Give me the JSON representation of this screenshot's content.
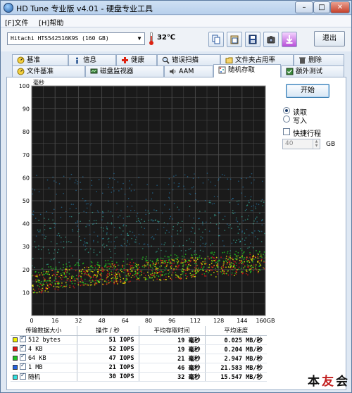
{
  "window": {
    "title": "HD Tune 专业版 v4.01 - 硬盘专业工具",
    "min": "–",
    "max": "□",
    "close": "✕"
  },
  "menu": [
    "[F]文件",
    "[H]帮助"
  ],
  "toolbar": {
    "drive": "Hitachi HTS542516K9S  (160 GB)",
    "temperature": "32℃",
    "exit": "退出",
    "buttons": [
      "copy-icon",
      "paste-icon",
      "save-icon",
      "camera-icon",
      "download-icon"
    ]
  },
  "tabs_row1": [
    {
      "label": "基准",
      "icon": "benchmark-icon"
    },
    {
      "label": "信息",
      "icon": "info-icon"
    },
    {
      "label": "健康",
      "icon": "health-icon"
    },
    {
      "label": "错误扫描",
      "icon": "scan-icon"
    },
    {
      "label": "文件夹占用率",
      "icon": "folder-icon"
    },
    {
      "label": "删除",
      "icon": "trash-icon"
    }
  ],
  "tabs_row2": [
    {
      "label": "文件基准",
      "icon": "file-benchmark-icon"
    },
    {
      "label": "磁盘监视器",
      "icon": "monitor-icon"
    },
    {
      "label": "AAM",
      "icon": "speaker-icon"
    },
    {
      "label": "随机存取",
      "icon": "random-access-icon",
      "active": true
    },
    {
      "label": "额外测试",
      "icon": "extra-tests-icon"
    }
  ],
  "controls": {
    "start": "开始",
    "read": "读取",
    "write": "写入",
    "quick": "快捷行程",
    "quick_value": "40",
    "quick_unit": "GB"
  },
  "chart_data": {
    "type": "scatter",
    "ylabel": "毫秒",
    "ylim": [
      0,
      100
    ],
    "xlim": [
      0,
      160
    ],
    "yticks": [
      "100",
      "90",
      "80",
      "70",
      "60",
      "50",
      "40",
      "30",
      "20",
      "10"
    ],
    "xticks": [
      "0",
      "16",
      "32",
      "48",
      "64",
      "80",
      "96",
      "112",
      "128",
      "144",
      "160GB"
    ],
    "grid": true,
    "background": "#1a1a1a",
    "series": [
      {
        "name": "512 bytes",
        "color": "#f0f000",
        "approx_latency_ms": [
          14,
          20
        ]
      },
      {
        "name": "4 KB",
        "color": "#e01818",
        "approx_latency_ms": [
          14,
          20
        ]
      },
      {
        "name": "64 KB",
        "color": "#20c020",
        "approx_latency_ms": [
          15,
          22
        ]
      },
      {
        "name": "1 MB",
        "color": "#2890d0",
        "approx_latency_ms": [
          30,
          60
        ]
      },
      {
        "name": "随机",
        "color": "#40d8c0",
        "approx_latency_ms": [
          15,
          40
        ]
      }
    ]
  },
  "table": {
    "headers": [
      "传输数据大小",
      "操作 / 秒",
      "平均存取时间",
      "平均速度"
    ],
    "rows": [
      {
        "color": "#f0f000",
        "size": "512 bytes",
        "ops": "51 IOPS",
        "access": "19 毫秒",
        "speed": "0.025 MB/秒"
      },
      {
        "color": "#e01818",
        "size": "4 KB",
        "ops": "52 IOPS",
        "access": "19 毫秒",
        "speed": "0.204 MB/秒"
      },
      {
        "color": "#20c020",
        "size": "64 KB",
        "ops": "47 IOPS",
        "access": "21 毫秒",
        "speed": "2.947 MB/秒"
      },
      {
        "color": "#2060e0",
        "size": "1 MB",
        "ops": "21 IOPS",
        "access": "46 毫秒",
        "speed": "21.583 MB/秒"
      },
      {
        "color": "#30e0e0",
        "size": "随机",
        "ops": "30 IOPS",
        "access": "32 毫秒",
        "speed": "15.547 MB/秒"
      }
    ]
  },
  "watermark": {
    "a": "本",
    "b": "友",
    "c": "会"
  }
}
